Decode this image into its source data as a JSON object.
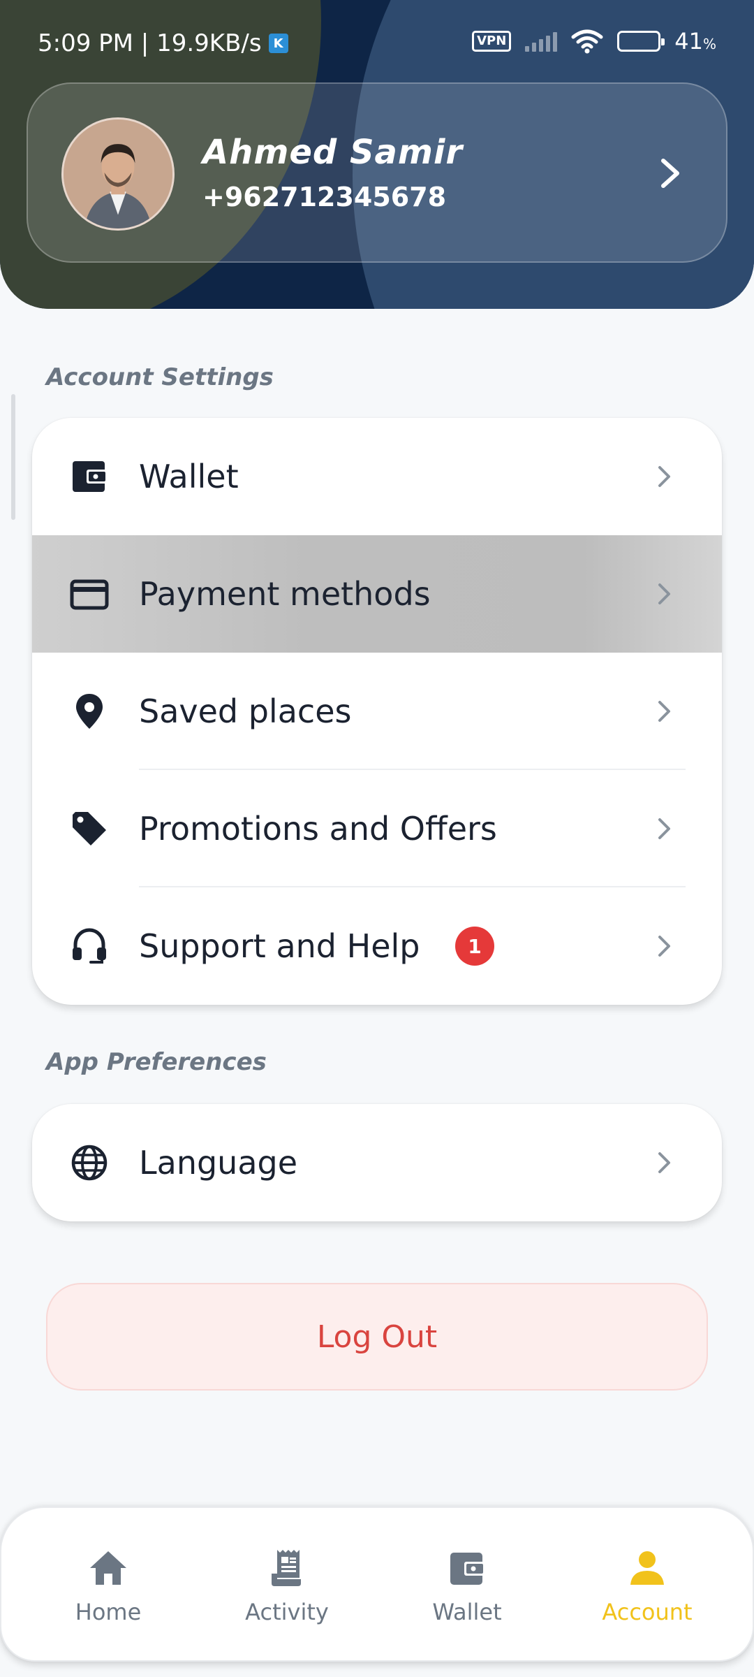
{
  "status_bar": {
    "time_speed": "5:09 PM | 19.9KB/s",
    "app_icon": "teal-app-icon",
    "vpn": "VPN",
    "battery_percent": "41",
    "battery_unit": "%",
    "battery_level": 0.41
  },
  "profile": {
    "name": "Ahmed Samir",
    "phone": "+962712345678"
  },
  "account_settings": {
    "title": "Account Settings",
    "items": [
      {
        "label": "Wallet",
        "icon": "wallet-icon"
      },
      {
        "label": "Payment methods",
        "icon": "credit-card-icon"
      },
      {
        "label": "Saved places",
        "icon": "location-pin-icon"
      },
      {
        "label": "Promotions and Offers",
        "icon": "tag-icon"
      },
      {
        "label": "Support and Help",
        "icon": "headset-icon",
        "badge": "1"
      }
    ]
  },
  "app_preferences": {
    "title": "App Preferences",
    "items": [
      {
        "label": "Language",
        "icon": "globe-icon"
      }
    ]
  },
  "logout_label": "Log Out",
  "bottom_nav": {
    "items": [
      {
        "label": "Home",
        "icon": "home-icon"
      },
      {
        "label": "Activity",
        "icon": "receipt-icon"
      },
      {
        "label": "Wallet",
        "icon": "wallet-icon"
      },
      {
        "label": "Account",
        "icon": "person-icon",
        "active": true
      }
    ]
  },
  "colors": {
    "accent": "#f1c21b",
    "badge": "#e53939",
    "logout_text": "#d9443f",
    "logout_bg": "#fdeeed",
    "icon_dark": "#1b2230",
    "nav_inactive": "#6b7683"
  }
}
